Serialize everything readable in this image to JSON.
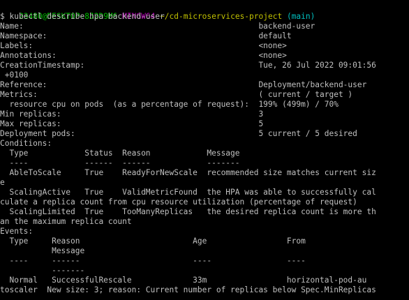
{
  "prompt": {
    "user_host": "23480@DESKTOP-8J2D9M6",
    "shell": "MINGW64",
    "path": "~/cd-microservices-project",
    "branch": "(main)",
    "colors": {
      "user_host": "#00c000",
      "shell": "#c000c0",
      "path": "#c0c000",
      "branch": "#00c0c0"
    }
  },
  "command": "$ kubectl describe hpa backend-user",
  "output_lines": [
    "Name:                                                  backend-user",
    "Namespace:                                             default",
    "Labels:                                                <none>",
    "Annotations:                                           <none>",
    "CreationTimestamp:                                     Tue, 26 Jul 2022 09:01:56",
    " +0100",
    "Reference:                                             Deployment/backend-user",
    "Metrics:                                               ( current / target )",
    "  resource cpu on pods  (as a percentage of request):  199% (499m) / 70%",
    "Min replicas:                                          3",
    "Max replicas:                                          5",
    "Deployment pods:                                       5 current / 5 desired",
    "Conditions:",
    "  Type            Status  Reason            Message",
    "  ----            ------  ------            -------",
    "  AbleToScale     True    ReadyForNewScale  recommended size matches current siz",
    "e",
    "  ScalingActive   True    ValidMetricFound  the HPA was able to successfully cal",
    "culate a replica count from cpu resource utilization (percentage of request)",
    "  ScalingLimited  True    TooManyReplicas   the desired replica count is more th",
    "an the maximum replica count",
    "Events:",
    "  Type     Reason                        Age                 From",
    "           Message",
    "  ----     ------                        ----                ----",
    "           -------",
    "  Normal   SuccessfulRescale             33m                 horizontal-pod-au",
    "toscaler  New size: 3; reason: Current number of replicas below Spec.MinReplicas"
  ],
  "colors": {
    "background": "#000000",
    "foreground": "#c0c0c0"
  }
}
